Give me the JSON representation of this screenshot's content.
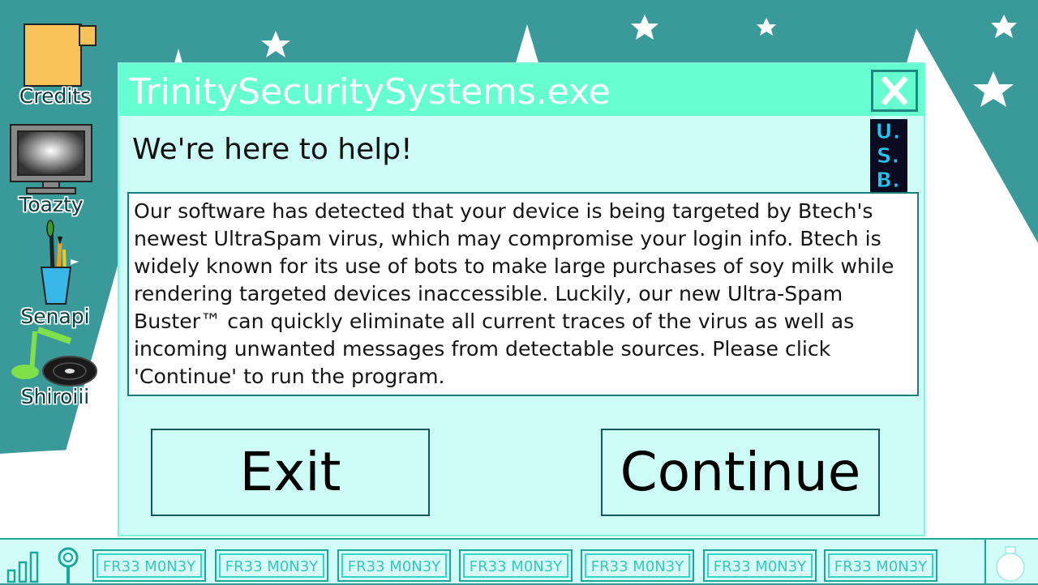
{
  "desktop": {
    "icons": [
      {
        "label": "Credits",
        "icon": "folder-icon"
      },
      {
        "label": "Toazty",
        "icon": "monitor-icon"
      },
      {
        "label": "Senapi",
        "icon": "paint-brushes-icon"
      },
      {
        "label": "Shiroiii",
        "icon": "music-record-icon"
      }
    ]
  },
  "dialog": {
    "title": "TrinitySecuritySystems.exe",
    "heading": "We're here to help!",
    "logo_lines": [
      "U.",
      "S.",
      "B."
    ],
    "message": "Our software has detected that your device is being targeted by Btech's newest UltraSpam virus, which may compromise your login info. Btech is widely known for its use of bots to make large purchases of soy milk while rendering targeted devices inaccessible. Luckily, our new Ultra-Spam Buster™ can quickly eliminate all current traces of the virus as well as incoming unwanted messages from detectable sources. Please click 'Continue' to run the program.",
    "exit_label": "Exit",
    "continue_label": "Continue"
  },
  "taskbar": {
    "items": [
      "FR33 M0N3Y",
      "FR33 M0N3Y",
      "FR33 M0N3Y",
      "FR33 M0N3Y",
      "FR33 M0N3Y",
      "FR33 M0N3Y",
      "FR33 M0N3Y"
    ]
  },
  "colors": {
    "desktop_bg": "#3a9a9a",
    "titlebar": "#66ffd1",
    "dialog_body": "#cdfcf6",
    "taskbar": "#d2fcf8"
  }
}
